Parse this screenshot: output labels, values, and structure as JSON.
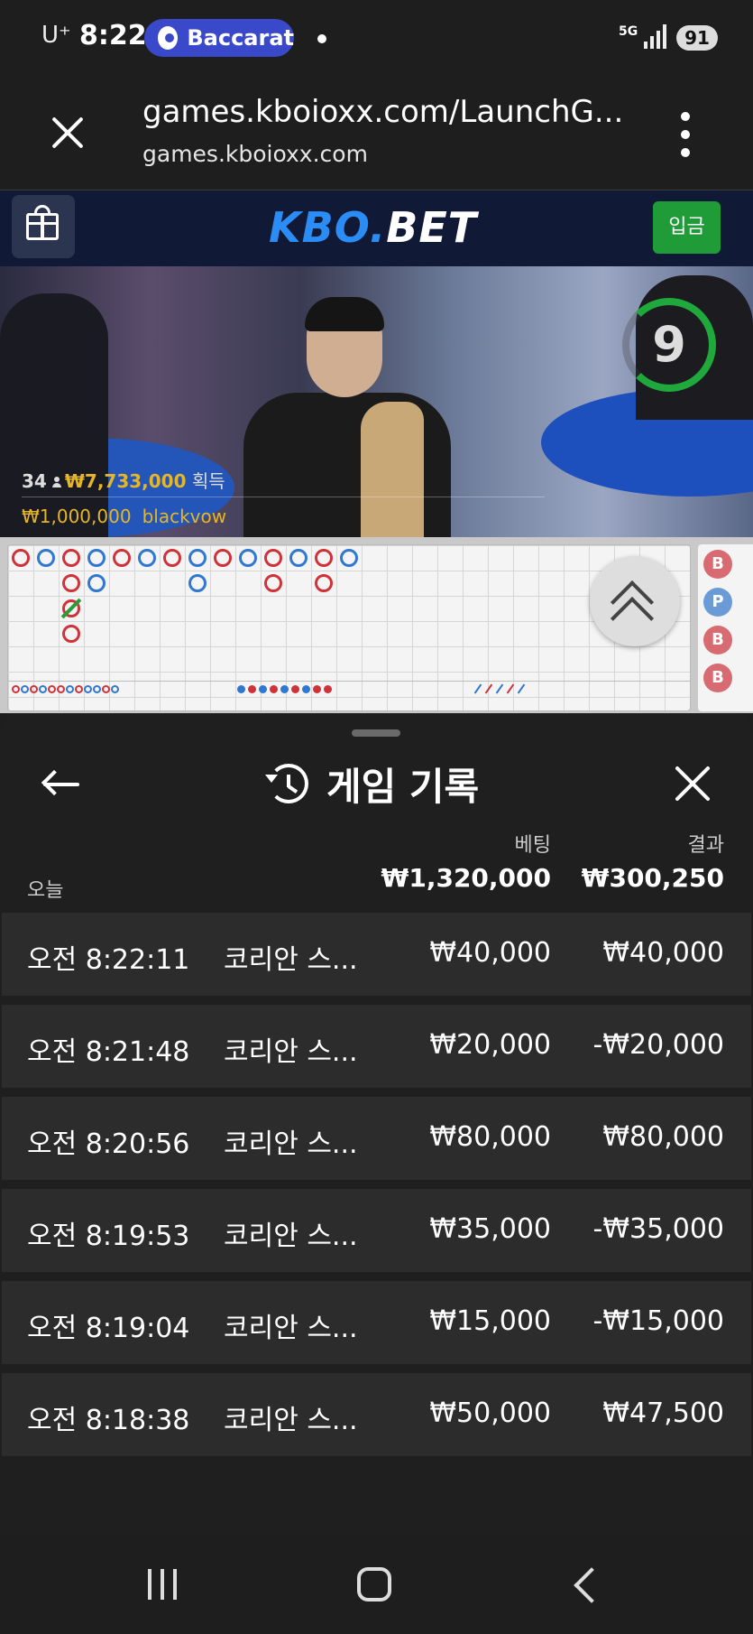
{
  "status_bar": {
    "carrier": "U⁺",
    "time": "8:22",
    "app_pill": "Baccarat",
    "network": "5G",
    "battery": "91"
  },
  "browser": {
    "url_title": "games.kboioxx.com/LaunchG...",
    "domain": "games.kboioxx.com"
  },
  "site": {
    "logo_part1": "KBO.",
    "logo_part2": "BET",
    "deposit_label": "입금"
  },
  "video": {
    "countdown": "9",
    "player_count": "34",
    "winnings": "₩7,733,000",
    "winnings_label": "획득",
    "last_bet_amount": "₩1,000,000",
    "last_bet_user": "blackvow"
  },
  "roadmap": {
    "big_road_top_row": [
      "B",
      "P",
      "B",
      "P",
      "B",
      "P",
      "B",
      "P",
      "B",
      "P",
      "B",
      "P",
      "B",
      "P"
    ],
    "bead_road": [
      "B",
      "P",
      "B",
      "B"
    ]
  },
  "history": {
    "title": "게임 기록",
    "col_bet": "베팅",
    "col_result": "결과",
    "today_label": "오늘",
    "total_bet": "₩1,320,000",
    "total_result": "₩300,250",
    "rows": [
      {
        "time": "오전 8:22:11",
        "game": "코리안 스...",
        "bet": "₩40,000",
        "result": "₩40,000"
      },
      {
        "time": "오전 8:21:48",
        "game": "코리안 스...",
        "bet": "₩20,000",
        "result": "-₩20,000"
      },
      {
        "time": "오전 8:20:56",
        "game": "코리안 스...",
        "bet": "₩80,000",
        "result": "₩80,000"
      },
      {
        "time": "오전 8:19:53",
        "game": "코리안 스...",
        "bet": "₩35,000",
        "result": "-₩35,000"
      },
      {
        "time": "오전 8:19:04",
        "game": "코리안 스...",
        "bet": "₩15,000",
        "result": "-₩15,000"
      },
      {
        "time": "오전 8:18:38",
        "game": "코리안 스...",
        "bet": "₩50,000",
        "result": "₩47,500"
      }
    ]
  },
  "icons": {
    "close": "close-icon",
    "menu": "more-vert-icon",
    "gift": "gift-icon",
    "back": "arrow-left-icon",
    "history": "history-icon",
    "expand": "chevron-up-double-icon"
  },
  "colors": {
    "accent_blue": "#2b8cf5",
    "deposit_green": "#1f9c37",
    "gold": "#e5b628",
    "banker_red": "#d0323a",
    "player_blue": "#2f77d0"
  }
}
